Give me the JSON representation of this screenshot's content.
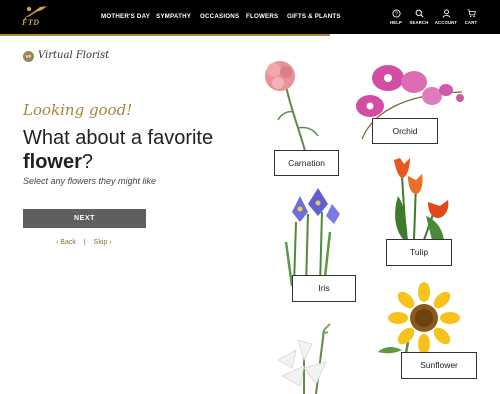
{
  "header": {
    "logo_text": "FTD",
    "nav": [
      "MOTHER'S DAY",
      "SYMPATHY",
      "OCCASIONS",
      "FLOWERS",
      "GIFTS & PLANTS"
    ],
    "utilities": [
      {
        "icon": "help-icon",
        "label": "HELP"
      },
      {
        "icon": "search-icon",
        "label": "SEARCH"
      },
      {
        "icon": "account-icon",
        "label": "ACCOUNT"
      },
      {
        "icon": "cart-icon",
        "label": "CART"
      }
    ]
  },
  "brand": {
    "badge": "VF",
    "name": "Virtual Florist"
  },
  "prompt": {
    "eyebrow": "Looking good!",
    "question_start": "What about a favorite ",
    "question_bold": "flower",
    "question_end": "?",
    "subtitle": "Select any flowers they might like"
  },
  "actions": {
    "next": "NEXT",
    "back": "Back",
    "skip": "Skip"
  },
  "flowers": [
    {
      "id": "carnation",
      "label": "Carnation",
      "color": "#e8929a"
    },
    {
      "id": "orchid",
      "label": "Orchid",
      "color": "#d24da3"
    },
    {
      "id": "iris",
      "label": "Iris",
      "color": "#6d6fd8"
    },
    {
      "id": "tulip",
      "label": "Tulip",
      "color": "#e8581e"
    },
    {
      "id": "lily",
      "label": "",
      "color": "#f4f4f4"
    },
    {
      "id": "sunflower",
      "label": "Sunflower",
      "color": "#f7c21b"
    }
  ],
  "colors": {
    "gold": "#b08a3e",
    "header": "#000000",
    "button": "#5f5f5f"
  }
}
